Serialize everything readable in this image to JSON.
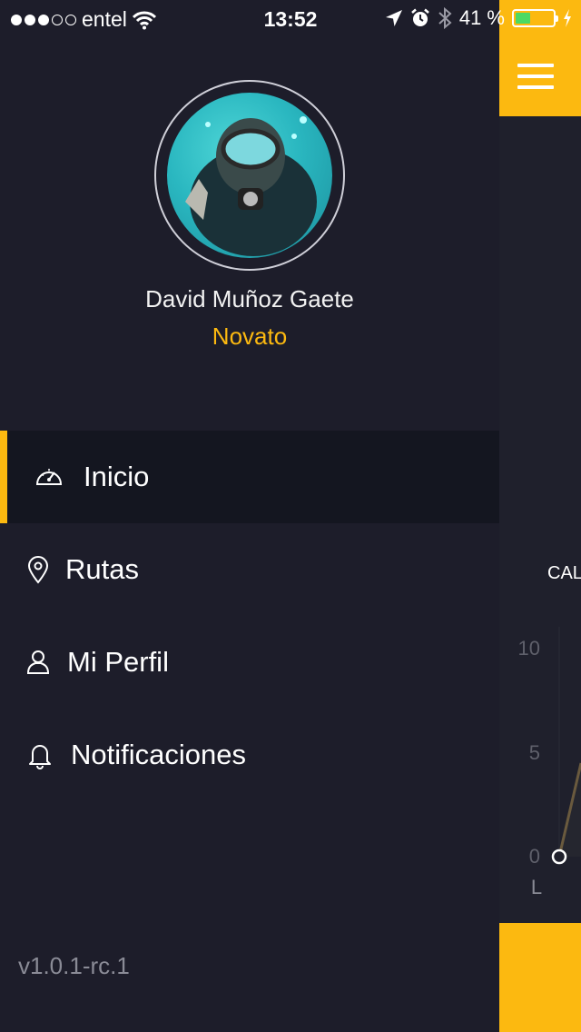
{
  "status_bar": {
    "carrier": "entel",
    "signal_dots_filled": 3,
    "signal_dots_total": 5,
    "time": "13:52",
    "battery_percent": "41 %",
    "battery_level": 0.41,
    "battery_color": "#4cd964",
    "icons": [
      "wifi-icon",
      "location-arrow-icon",
      "alarm-clock-icon",
      "bluetooth-icon",
      "charging-bolt-icon"
    ]
  },
  "profile": {
    "name": "David Muñoz Gaete",
    "level": "Novato",
    "level_color": "#fcb910"
  },
  "menu": {
    "items": [
      {
        "label": "Inicio",
        "icon": "speedometer-icon",
        "active": true
      },
      {
        "label": "Rutas",
        "icon": "map-pin-icon",
        "active": false
      },
      {
        "label": "Mi Perfil",
        "icon": "user-icon",
        "active": false
      },
      {
        "label": "Notificaciones",
        "icon": "bell-icon",
        "active": false
      }
    ]
  },
  "version": "v1.0.1-rc.1",
  "main": {
    "header_icon": "hamburger-menu-icon",
    "accent_color": "#fcb910",
    "section_label": "CAL",
    "chart": {
      "y_ticks": [
        "10",
        "5",
        "0"
      ],
      "x_tick": "L"
    }
  }
}
